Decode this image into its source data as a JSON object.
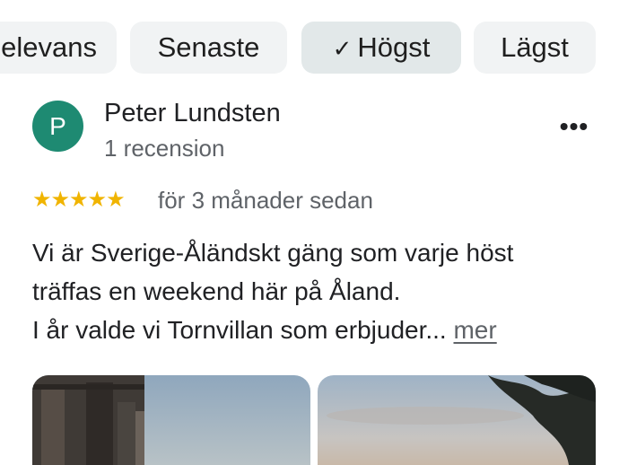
{
  "filters": {
    "chips": [
      {
        "label": "elevans",
        "selected": false
      },
      {
        "label": "Senaste",
        "selected": false
      },
      {
        "label": "Högst",
        "selected": true
      },
      {
        "label": "Lägst",
        "selected": false
      }
    ],
    "check_icon": "check-icon"
  },
  "review": {
    "author": {
      "initial": "P",
      "name": "Peter Lundsten",
      "review_count": "1 recension",
      "avatar_color": "#1e8a72"
    },
    "menu_icon": "more-horizontal-icon",
    "rating": 5,
    "star_color": "#f0b400",
    "time": "för 3 månader sedan",
    "text_lines": [
      "Vi är Sverige-Åländskt gäng som varje höst",
      "träffas en weekend här på Åland.",
      "I år valde vi Tornvillan som erbjuder..."
    ],
    "more_label": "mer",
    "photos": [
      {
        "name": "review-photo-1"
      },
      {
        "name": "review-photo-2"
      }
    ]
  }
}
